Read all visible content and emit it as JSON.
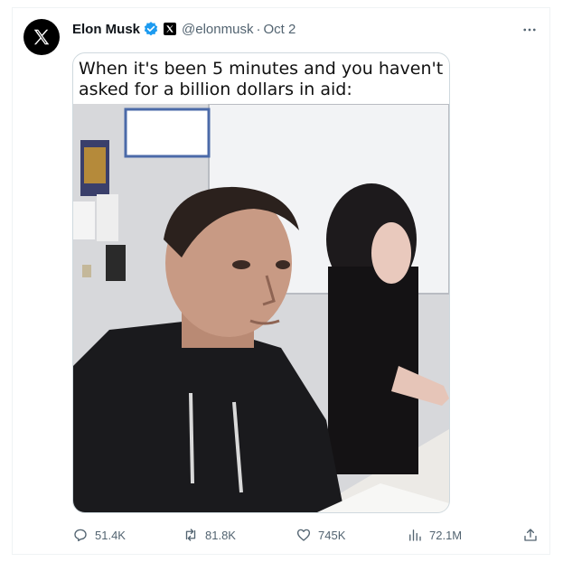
{
  "tweet": {
    "author_name": "Elon Musk",
    "handle": "@elonmusk",
    "separator": "·",
    "date": "Oct 2",
    "caption": "When it's been 5 minutes and you haven't asked for a billion dollars in aid:"
  },
  "stats": {
    "replies": "51.4K",
    "reposts": "81.8K",
    "likes": "745K",
    "views": "72.1M"
  },
  "colors": {
    "verified": "#1d9bf0",
    "muted": "#536471"
  }
}
